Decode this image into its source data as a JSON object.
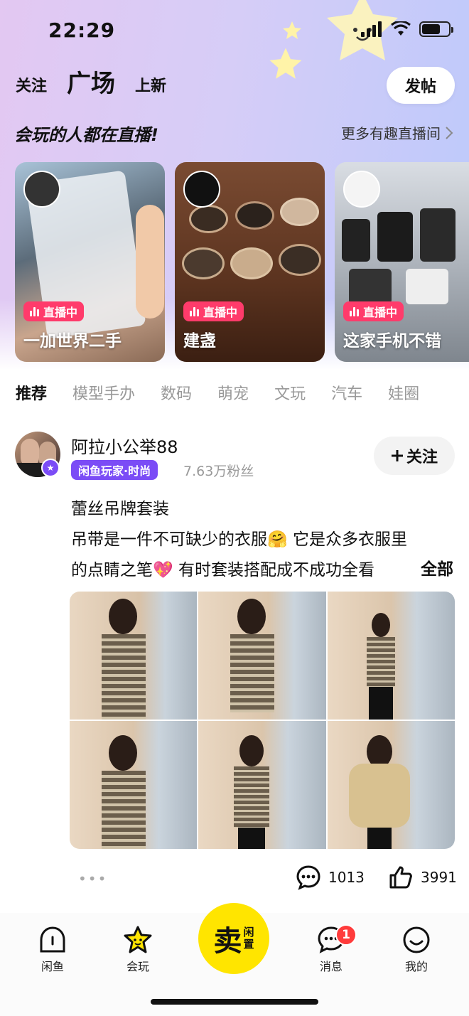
{
  "status_bar": {
    "time": "22:29"
  },
  "top_tabs": {
    "follow": "关注",
    "plaza": "广场",
    "new": "上新"
  },
  "post_button": "发帖",
  "live_section": {
    "title": "会玩的人都在直播!",
    "more": "更多有趣直播间",
    "badge": "直播中",
    "cards": [
      {
        "title": "一加世界二手"
      },
      {
        "title": "建盏"
      },
      {
        "title": "这家手机不错"
      }
    ]
  },
  "category_tabs": [
    "推荐",
    "模型手办",
    "数码",
    "萌宠",
    "文玩",
    "汽车",
    "娃圈"
  ],
  "post": {
    "username": "阿拉小公举88",
    "tag": "闲鱼玩家·时尚",
    "fans": "7.63万粉丝",
    "follow_label": "关注",
    "title": "蕾丝吊牌套装",
    "body_line1": "吊带是一件不可缺少的衣服🤗 它是众多衣服里",
    "body_line2": "的点睛之笔💖 有时套装搭配成不成功全看",
    "more_label": "全部",
    "comments": "1013",
    "likes": "3991"
  },
  "bottom_nav": {
    "home": "闲鱼",
    "play": "会玩",
    "sell_big": "卖",
    "sell_small_1": "闲",
    "sell_small_2": "置",
    "messages": "消息",
    "messages_badge": "1",
    "me": "我的"
  },
  "colors": {
    "accent_yellow": "#ffe500",
    "live_pink": "#ff3b6b",
    "tag_purple": "#7b4cf6"
  }
}
